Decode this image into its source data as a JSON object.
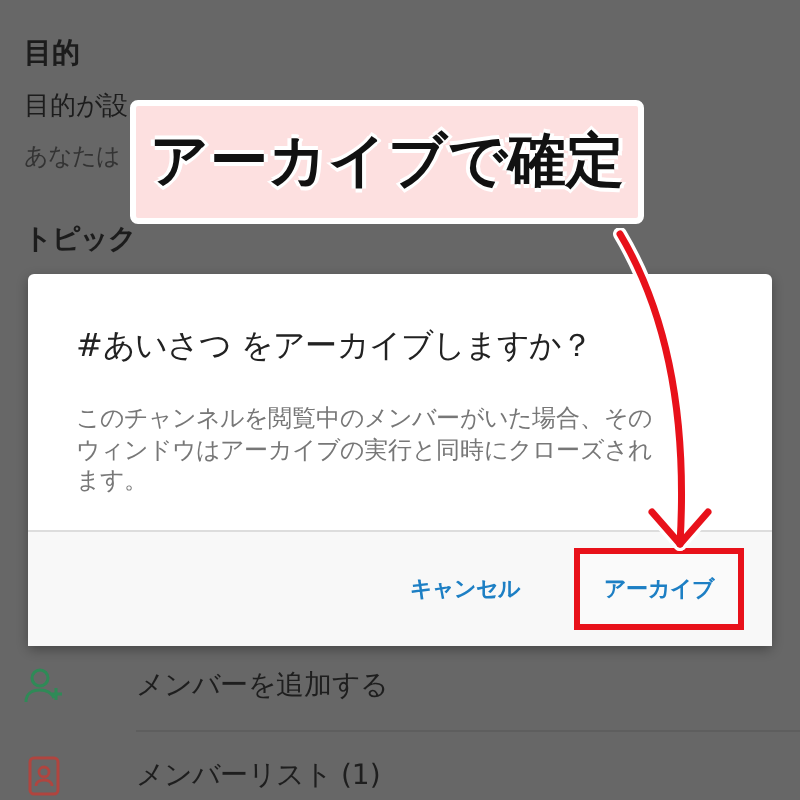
{
  "background": {
    "sections": [
      {
        "heading": "目的",
        "lines": [
          "目的が設",
          "あなたは"
        ]
      },
      {
        "heading": "トピック"
      }
    ],
    "actions": [
      {
        "kind": "add-member",
        "label": "メンバーを追加する"
      },
      {
        "kind": "member-list",
        "label": "メンバーリスト (1)"
      }
    ]
  },
  "dialog": {
    "title": "#あいさつ をアーカイブしますか？",
    "message": "このチャンネルを閲覧中のメンバーがいた場合、そのウィンドウはアーカイブの実行と同時にクローズされます。",
    "buttons": [
      {
        "label": "キャンセル",
        "highlighted": false
      },
      {
        "label": "アーカイブ",
        "highlighted": true
      }
    ]
  },
  "callout": {
    "text": "アーカイブで確定"
  }
}
